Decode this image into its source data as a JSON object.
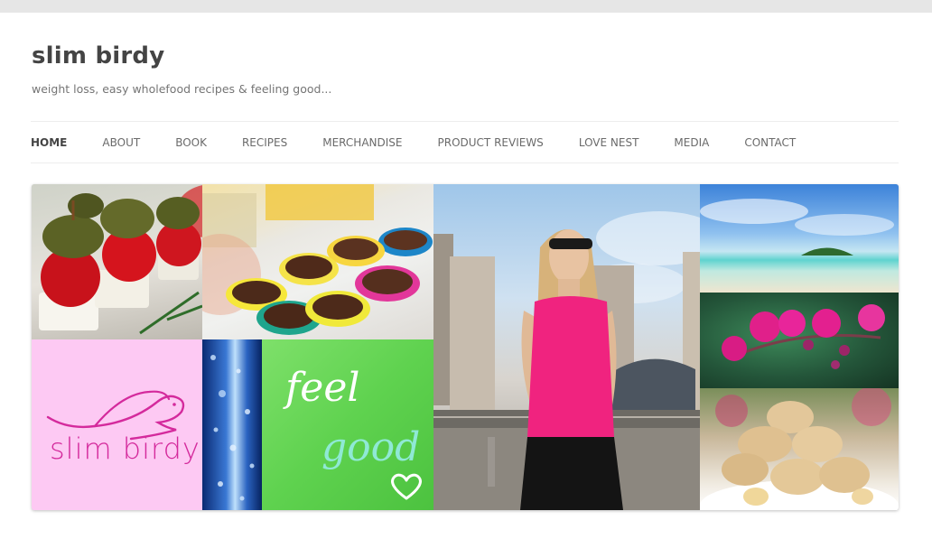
{
  "site": {
    "title": "slim birdy",
    "tagline": "weight loss, easy wholefood recipes & feeling good..."
  },
  "nav": {
    "items": [
      {
        "label": "HOME",
        "active": true
      },
      {
        "label": "ABOUT"
      },
      {
        "label": "BOOK"
      },
      {
        "label": "RECIPES"
      },
      {
        "label": "MERCHANDISE"
      },
      {
        "label": "PRODUCT REVIEWS"
      },
      {
        "label": "LOVE NEST"
      },
      {
        "label": "MEDIA"
      },
      {
        "label": "CONTACT"
      }
    ]
  },
  "banner": {
    "logo_text": "slim birdy",
    "feel_text": "feel",
    "good_text": "good"
  },
  "colors": {
    "logo_bg": "#fdc9f3",
    "logo_ink": "#d42a9c",
    "feel_bg": "#5fd24f",
    "tank_top": "#f0237f"
  }
}
